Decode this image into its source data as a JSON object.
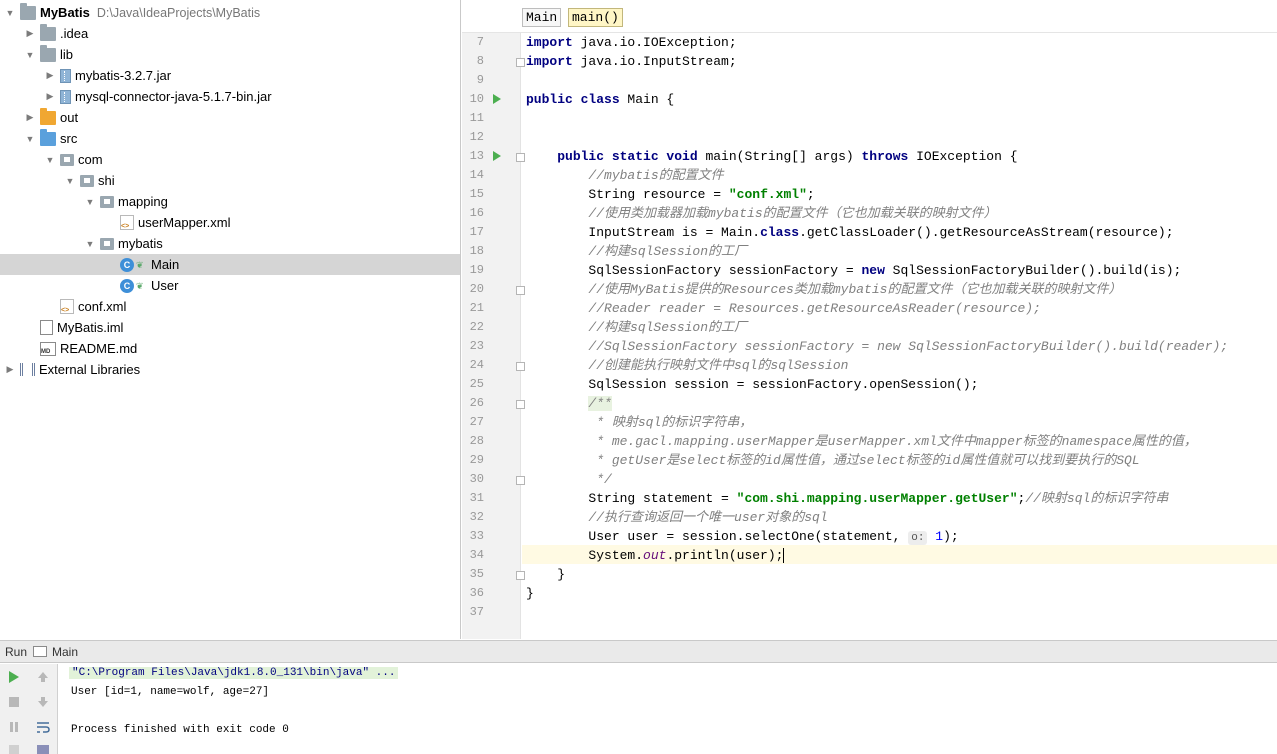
{
  "tree": {
    "project_name": "MyBatis",
    "project_path": "D:\\Java\\IdeaProjects\\MyBatis",
    "items": [
      {
        "label": ".idea"
      },
      {
        "label": "lib"
      },
      {
        "label": "mybatis-3.2.7.jar"
      },
      {
        "label": "mysql-connector-java-5.1.7-bin.jar"
      },
      {
        "label": "out"
      },
      {
        "label": "src"
      },
      {
        "label": "com"
      },
      {
        "label": "shi"
      },
      {
        "label": "mapping"
      },
      {
        "label": "userMapper.xml"
      },
      {
        "label": "mybatis"
      },
      {
        "label": "Main"
      },
      {
        "label": "User"
      },
      {
        "label": "conf.xml"
      },
      {
        "label": "MyBatis.iml"
      },
      {
        "label": "README.md"
      },
      {
        "label": "External Libraries"
      }
    ],
    "selected": "Main"
  },
  "editor": {
    "breadcrumbs": [
      "Main",
      "main()"
    ],
    "line_numbers": [
      "7",
      "8",
      "9",
      "10",
      "11",
      "12",
      "13",
      "14",
      "15",
      "16",
      "17",
      "18",
      "19",
      "20",
      "21",
      "22",
      "23",
      "24",
      "25",
      "26",
      "27",
      "28",
      "29",
      "30",
      "31",
      "32",
      "33",
      "34",
      "35",
      "36",
      "37"
    ],
    "current_line": "34",
    "lines": {
      "l7": [
        "import",
        " java.io.IOException;"
      ],
      "l8": [
        "import",
        " java.io.InputStream;"
      ],
      "l10": [
        "public class",
        " Main {"
      ],
      "l13": [
        "public static void",
        " main(String[] args) ",
        "throws",
        " IOException {"
      ],
      "l14": "//mybatis的配置文件",
      "l15": [
        "String resource = ",
        "\"conf.xml\"",
        ";"
      ],
      "l16": "//使用类加载器加载mybatis的配置文件（它也加载关联的映射文件）",
      "l17": [
        "InputStream is = Main.",
        "class",
        ".getClassLoader().getResourceAsStream(resource);"
      ],
      "l18": "//构建sqlSession的工厂",
      "l19": [
        "SqlSessionFactory sessionFactory = ",
        "new",
        " SqlSessionFactoryBuilder().build(is);"
      ],
      "l20": "//使用MyBatis提供的Resources类加载mybatis的配置文件（它也加载关联的映射文件）",
      "l21": "//Reader reader = Resources.getResourceAsReader(resource);",
      "l22": "//构建sqlSession的工厂",
      "l23": "//SqlSessionFactory sessionFactory = new SqlSessionFactoryBuilder().build(reader);",
      "l24": "//创建能执行映射文件中sql的sqlSession",
      "l25": "SqlSession session = sessionFactory.openSession();",
      "l26": "/**",
      "l27": " * 映射sql的标识字符串，",
      "l28": " * me.gacl.mapping.userMapper是userMapper.xml文件中mapper标签的namespace属性的值，",
      "l29": " * getUser是select标签的id属性值，通过select标签的id属性值就可以找到要执行的SQL",
      "l30": " */",
      "l31": [
        "String statement = ",
        "\"com.shi.mapping.userMapper.getUser\"",
        ";",
        "//映射sql的标识字符串"
      ],
      "l32": "//执行查询返回一个唯一user对象的sql",
      "l33": [
        "User user = session.selectOne(statement, ",
        "o:",
        "1",
        ");"
      ],
      "l34": [
        "System.",
        "out",
        ".println(user);"
      ],
      "l35": "}",
      "l36": "}"
    }
  },
  "run": {
    "label": "Run",
    "tab": "Main",
    "console": [
      "\"C:\\Program Files\\Java\\jdk1.8.0_131\\bin\\java\" ...",
      "User [id=1, name=wolf, age=27]",
      "",
      "Process finished with exit code 0"
    ]
  }
}
